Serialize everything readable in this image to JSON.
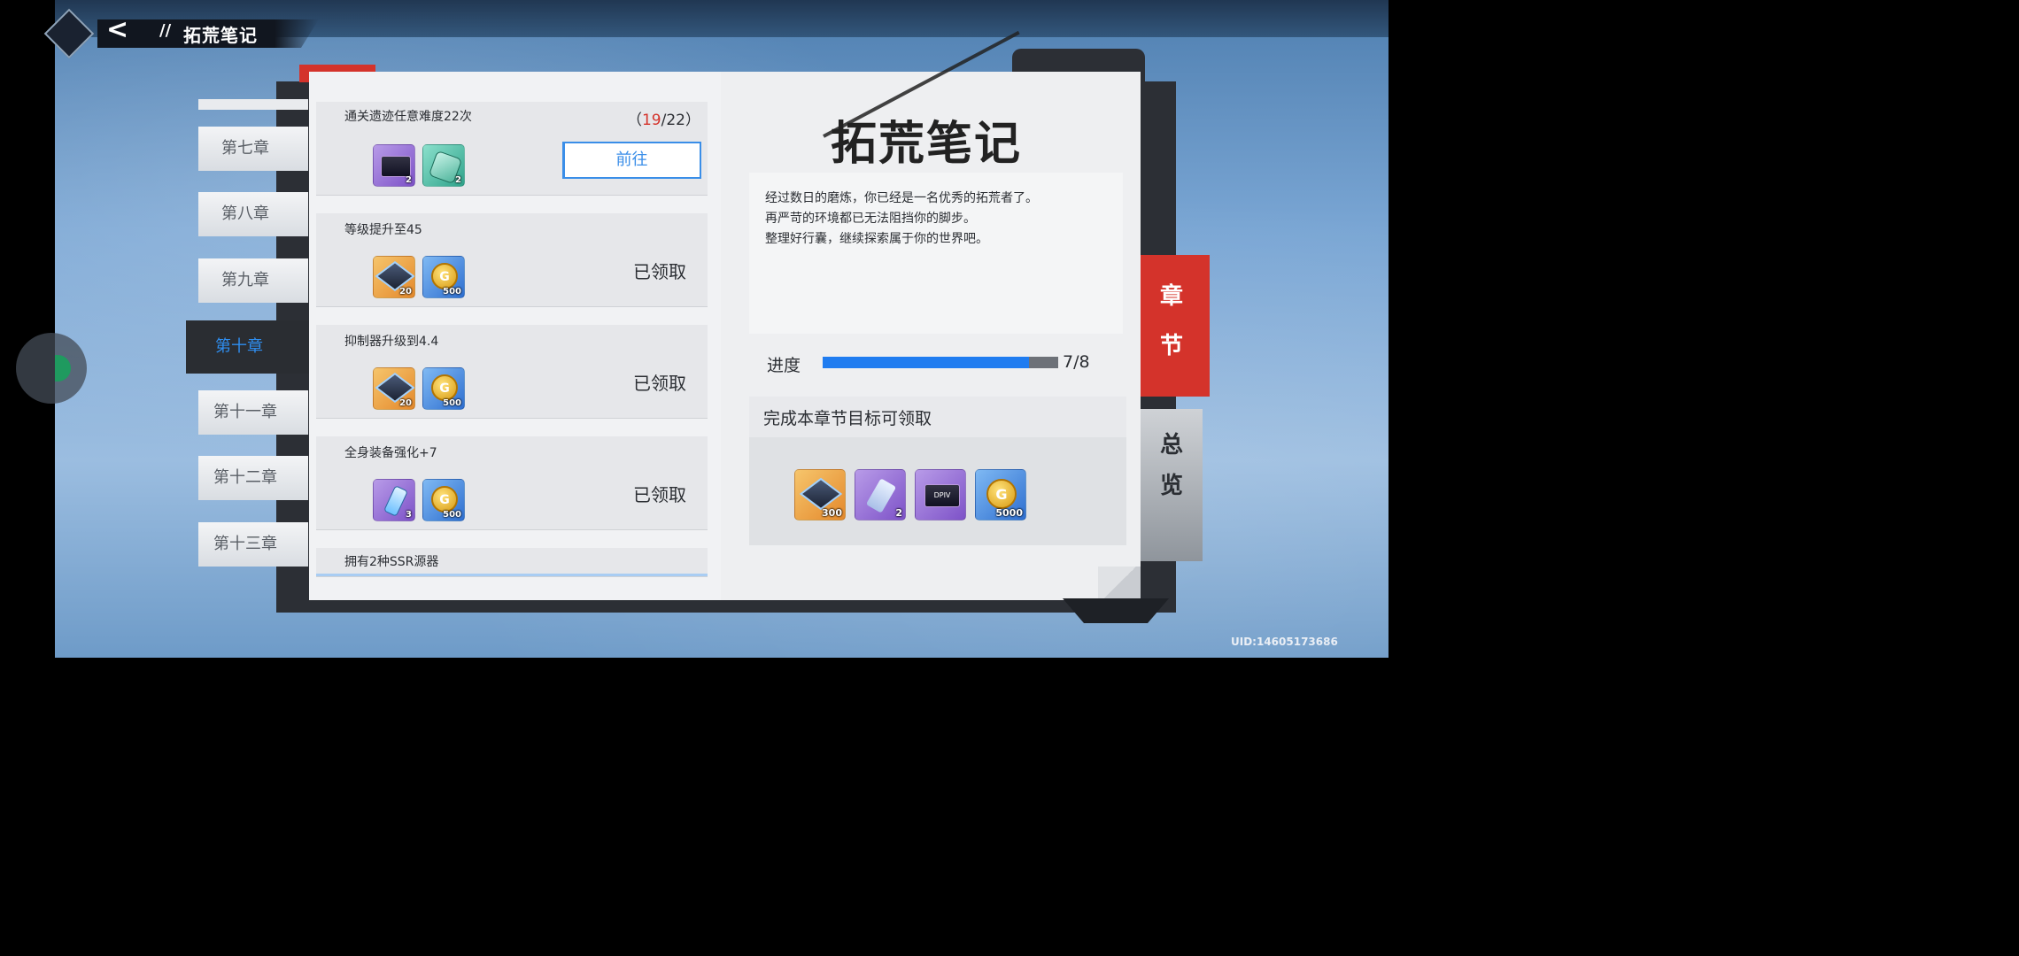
{
  "header": {
    "title": "拓荒笔记",
    "back_symbol": "<"
  },
  "chapters": [
    {
      "label": "第七章",
      "active": false
    },
    {
      "label": "第八章",
      "active": false
    },
    {
      "label": "第九章",
      "active": false
    },
    {
      "label": "第十章",
      "active": true
    },
    {
      "label": "第十一章",
      "active": false
    },
    {
      "label": "第十二章",
      "active": false
    },
    {
      "label": "第十三章",
      "active": false
    }
  ],
  "tasks": [
    {
      "name": "通关遗迹任意难度22次",
      "progress_open": "（",
      "progress_current": "19",
      "progress_sep": "/",
      "progress_total": "22",
      "progress_close": "）",
      "action": "前往",
      "rewards": [
        {
          "icon": "supply-box-icon",
          "qty": "2"
        },
        {
          "icon": "gear-part-icon",
          "qty": "2"
        }
      ]
    },
    {
      "name": "等级提升至45",
      "status": "已领取",
      "rewards": [
        {
          "icon": "cube-icon",
          "qty": "20"
        },
        {
          "icon": "gold-coin-icon",
          "qty": "500"
        }
      ]
    },
    {
      "name": "抑制器升级到4.4",
      "status": "已领取",
      "rewards": [
        {
          "icon": "cube-icon",
          "qty": "20"
        },
        {
          "icon": "gold-coin-icon",
          "qty": "500"
        }
      ]
    },
    {
      "name": "全身装备强化+7",
      "status": "已领取",
      "rewards": [
        {
          "icon": "vial-icon",
          "qty": "3"
        },
        {
          "icon": "gold-coin-icon",
          "qty": "500"
        }
      ]
    },
    {
      "name": "拥有2种SSR源器"
    }
  ],
  "notebook": {
    "title": "拓荒笔记",
    "description": [
      "经过数日的磨炼，你已经是一名优秀的拓荒者了。",
      "再严苛的环境都已无法阻挡你的脚步。",
      "整理好行囊，继续探索属于你的世界吧。"
    ],
    "progress_label": "进度",
    "progress_value": 7,
    "progress_max": 8,
    "progress_text": "7/8",
    "reward_title": "完成本章节目标可领取",
    "rewards": [
      {
        "icon": "cube-icon",
        "qty": "300"
      },
      {
        "icon": "crystal-shard-icon",
        "qty": "2"
      },
      {
        "icon": "dpiv-chip-icon",
        "qty": "",
        "text": "DPIV"
      },
      {
        "icon": "gold-coin-icon",
        "qty": "5000"
      }
    ]
  },
  "side_tabs": [
    {
      "chars": [
        "章",
        "节"
      ],
      "active": true
    },
    {
      "chars": [
        "总",
        "览"
      ],
      "active": false
    }
  ],
  "coin_glyph": "G",
  "uid": "UID:14605173686",
  "colors": {
    "accent_blue": "#1f7cf0",
    "tab_red": "#d4332b",
    "count_red": "#d4332b"
  }
}
